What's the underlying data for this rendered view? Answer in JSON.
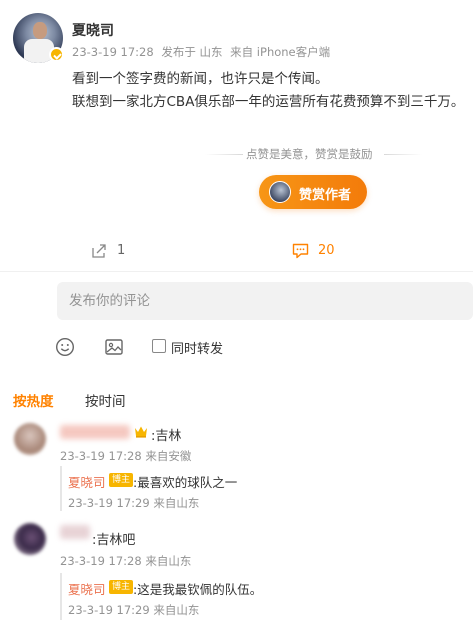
{
  "post": {
    "author": "夏晓司",
    "time": "23-3-19 17:28",
    "location": "发布于 山东",
    "source": "来自 iPhone客户端",
    "text_line1": "看到一个签字费的新闻，也许只是个传闻。",
    "text_line2": "联想到一家北方CBA俱乐部一年的运营所有花费预算不到三千万。"
  },
  "reward": {
    "slogan": "点赞是美意，赞赏是鼓励",
    "button_label": "赞赏作者"
  },
  "actions": {
    "share_count": "1",
    "comment_count": "20"
  },
  "composer": {
    "placeholder": "发布你的评论",
    "repost_label": "同时转发"
  },
  "sort": {
    "hot": "按热度",
    "time": "按时间"
  },
  "comments": [
    {
      "text": ":吉林",
      "meta": "23-3-19 17:28 来自安徽",
      "reply": {
        "author": "夏晓司",
        "badge": "博主",
        "text": ":最喜欢的球队之一",
        "meta": "23-3-19 17:29 来自山东"
      }
    },
    {
      "text": ":吉林吧",
      "meta": "23-3-19 17:28 来自山东",
      "reply": {
        "author": "夏晓司",
        "badge": "博主",
        "text": ":这是我最钦佩的队伍。",
        "meta": "23-3-19 17:29 来自山东"
      }
    }
  ],
  "colors": {
    "accent": "#ff8200",
    "name_link": "#eb7350",
    "meta_gray": "#939393"
  },
  "icons": [
    "verified-badge-icon",
    "share-icon",
    "comment-icon",
    "emoji-icon",
    "image-icon",
    "crown-icon"
  ]
}
